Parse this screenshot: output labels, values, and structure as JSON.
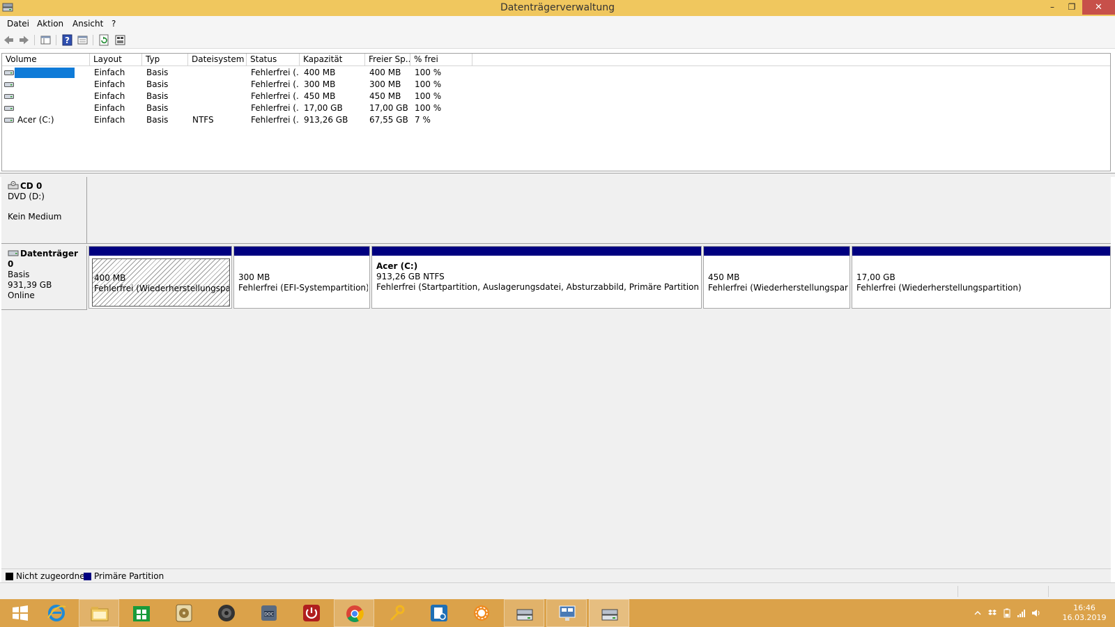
{
  "window": {
    "title": "Datenträgerverwaltung",
    "min_glyph": "–",
    "max_glyph": "❐",
    "close_glyph": "✕"
  },
  "menu": [
    "Datei",
    "Aktion",
    "Ansicht",
    "?"
  ],
  "toolbar": {
    "icons": [
      "back-arrow-icon",
      "forward-arrow-icon",
      "console-tree-icon",
      "help-icon",
      "properties-icon",
      "refresh-icon",
      "rescan-icon"
    ]
  },
  "volume_list": {
    "columns": [
      "Volume",
      "Layout",
      "Typ",
      "Dateisystem",
      "Status",
      "Kapazität",
      "Freier Sp...",
      "% frei"
    ],
    "rows": [
      {
        "volume": "",
        "layout": "Einfach",
        "typ": "Basis",
        "dateisystem": "",
        "status": "Fehlerfrei (...",
        "kapazitaet": "400 MB",
        "frei": "400 MB",
        "prozent": "100 %",
        "selected": true
      },
      {
        "volume": "",
        "layout": "Einfach",
        "typ": "Basis",
        "dateisystem": "",
        "status": "Fehlerfrei (...",
        "kapazitaet": "300 MB",
        "frei": "300 MB",
        "prozent": "100 %"
      },
      {
        "volume": "",
        "layout": "Einfach",
        "typ": "Basis",
        "dateisystem": "",
        "status": "Fehlerfrei (...",
        "kapazitaet": "450 MB",
        "frei": "450 MB",
        "prozent": "100 %"
      },
      {
        "volume": "",
        "layout": "Einfach",
        "typ": "Basis",
        "dateisystem": "",
        "status": "Fehlerfrei (...",
        "kapazitaet": "17,00 GB",
        "frei": "17,00 GB",
        "prozent": "100 %"
      },
      {
        "volume": "Acer (C:)",
        "layout": "Einfach",
        "typ": "Basis",
        "dateisystem": "NTFS",
        "status": "Fehlerfrei (...",
        "kapazitaet": "913,26 GB",
        "frei": "67,55 GB",
        "prozent": "7 %"
      }
    ]
  },
  "disks": {
    "cd0": {
      "name": "CD 0",
      "type": "DVD (D:)",
      "media": "Kein Medium"
    },
    "disk0": {
      "name": "Datenträger 0",
      "type": "Basis",
      "size": "931,39 GB",
      "state": "Online",
      "partitions": [
        {
          "title": "",
          "size": "400 MB",
          "status": "Fehlerfrei (Wiederherstellungspartition)",
          "selected": true
        },
        {
          "title": "",
          "size": "300 MB",
          "status": "Fehlerfrei (EFI-Systempartition)"
        },
        {
          "title": "Acer  (C:)",
          "size": "913,26 GB NTFS",
          "status": "Fehlerfrei (Startpartition, Auslagerungsdatei, Absturzabbild, Primäre Partition)"
        },
        {
          "title": "",
          "size": "450 MB",
          "status": "Fehlerfrei (Wiederherstellungspartition)"
        },
        {
          "title": "",
          "size": "17,00 GB",
          "status": "Fehlerfrei (Wiederherstellungspartition)"
        }
      ]
    }
  },
  "legend": [
    {
      "label": "Nicht zugeordnet",
      "color": "#000000"
    },
    {
      "label": "Primäre Partition",
      "color": "#000080"
    }
  ],
  "colors": {
    "titlebar": "#f0c75e",
    "taskbar": "#dba24a",
    "partition_header": "#000080",
    "selection": "#0f7bd8",
    "close_button": "#c7504a"
  },
  "taskbar": {
    "apps": [
      "start-icon",
      "internet-explorer-icon",
      "file-explorer-icon",
      "store-icon",
      "disc-burner-icon",
      "speaker-app-icon",
      "doc-converter-icon",
      "power-app-icon",
      "chrome-icon",
      "tools-app-icon",
      "settings-app-icon",
      "sun-app-icon",
      "disk-management-icon",
      "network-app-icon",
      "disk-management-active-icon"
    ],
    "tray_icons": [
      "show-hidden-icons-icon",
      "dropbox-icon",
      "battery-icon",
      "signal-icon",
      "volume-icon"
    ],
    "time": "16:46",
    "date": "16.03.2019"
  }
}
